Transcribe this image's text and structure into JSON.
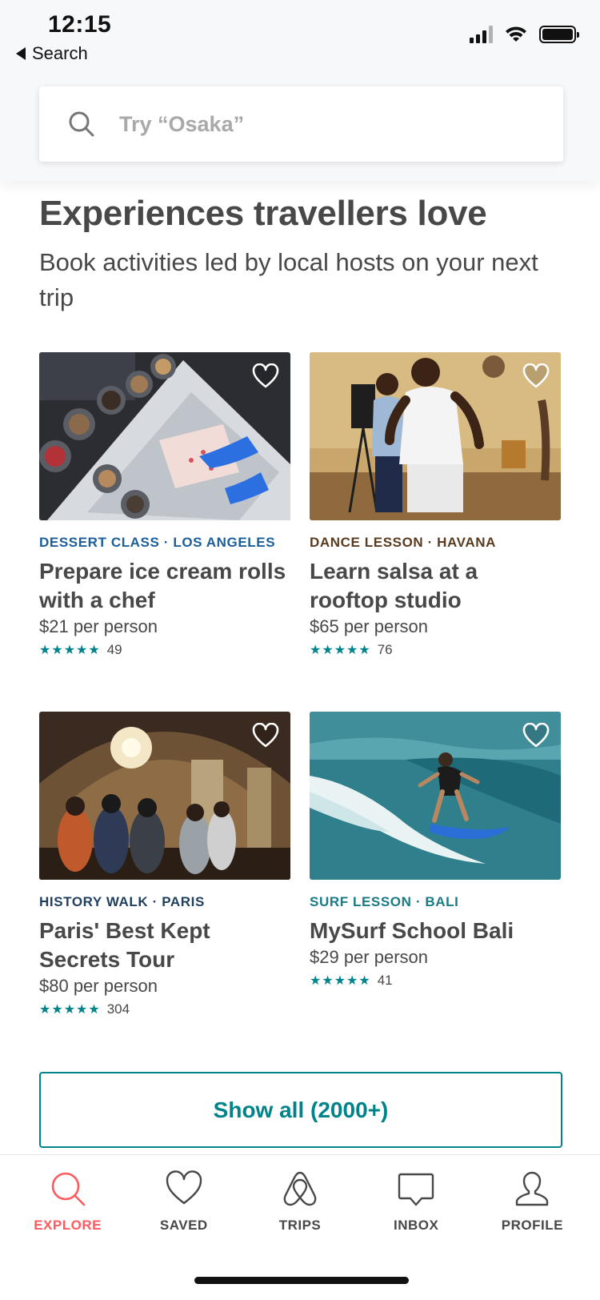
{
  "status_bar": {
    "time": "12:15",
    "back_label": "Search"
  },
  "search": {
    "placeholder": "Try “Osaka”"
  },
  "section": {
    "title": "Experiences travellers love",
    "subtitle": "Book activities led by local hosts on your next trip"
  },
  "cards": [
    {
      "category": "DESSERT CLASS · LOS ANGELES",
      "category_color": "#1b5e9a",
      "title": "Prepare ice cream rolls with a chef",
      "price": "$21 per person",
      "stars": "★★★★★",
      "rating": 4.5,
      "reviews": "49"
    },
    {
      "category": "DANCE LESSON · HAVANA",
      "category_color": "#5a3b1f",
      "title": "Learn salsa at a rooftop studio",
      "price": "$65 per person",
      "stars": "★★★★★",
      "rating": 5,
      "reviews": "76"
    },
    {
      "category": "HISTORY WALK · PARIS",
      "category_color": "#1f3f5e",
      "title": "Paris' Best Kept Secrets Tour",
      "price": "$80 per person",
      "stars": "★★★★★",
      "rating": 5,
      "reviews": "304"
    },
    {
      "category": "SURF LESSON · BALI",
      "category_color": "#1a7a86",
      "title": "MySurf School Bali",
      "price": "$29 per person",
      "stars": "★★★★★",
      "rating": 5,
      "reviews": "41"
    }
  ],
  "show_all_label": "Show all (2000+)",
  "tabs": [
    {
      "label": "EXPLORE",
      "icon": "search-icon",
      "active": true
    },
    {
      "label": "SAVED",
      "icon": "heart-icon",
      "active": false
    },
    {
      "label": "TRIPS",
      "icon": "airbnb-logo-icon",
      "active": false
    },
    {
      "label": "INBOX",
      "icon": "chat-icon",
      "active": false
    },
    {
      "label": "PROFILE",
      "icon": "user-icon",
      "active": false
    }
  ],
  "colors": {
    "accent": "#008489",
    "active_tab": "#ff5a5f",
    "text": "#484848"
  }
}
